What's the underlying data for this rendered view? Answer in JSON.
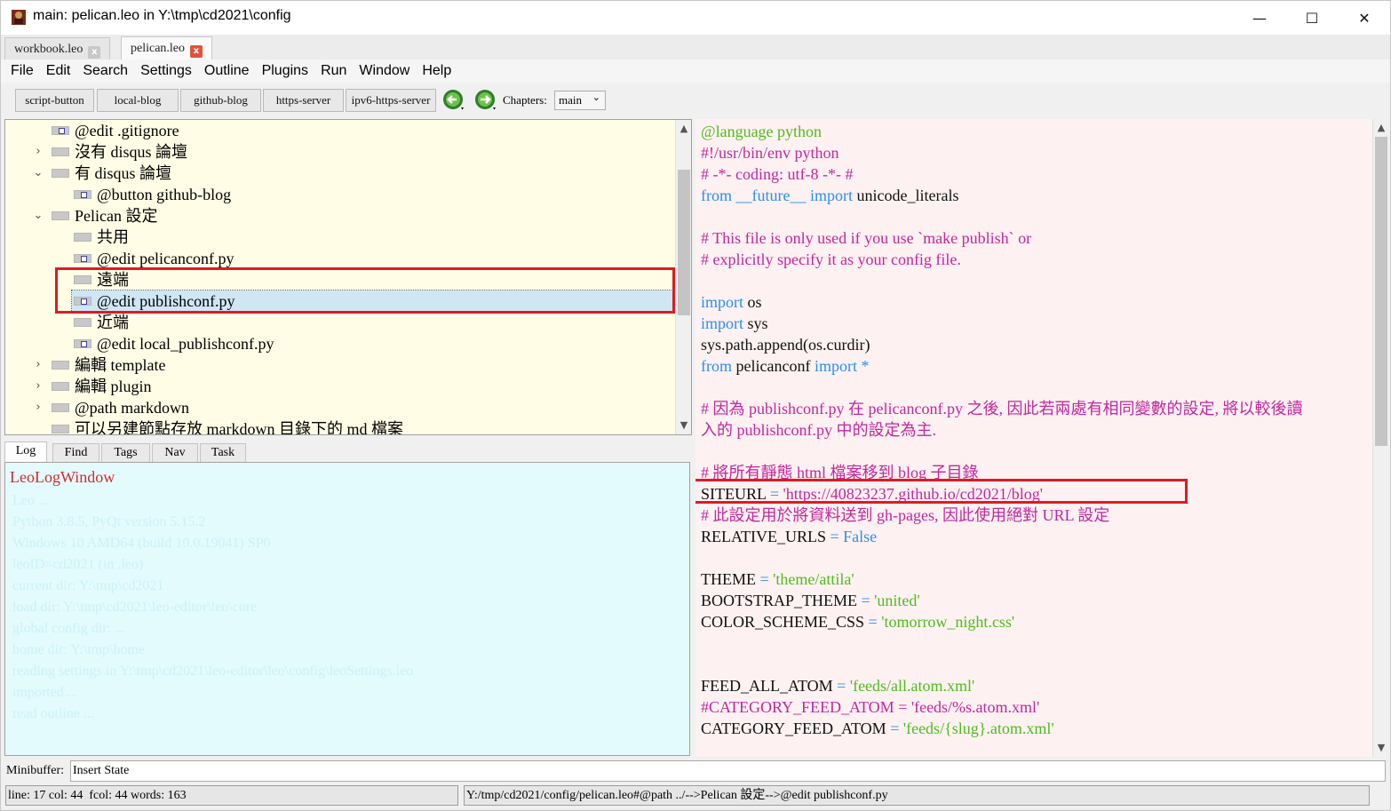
{
  "window": {
    "title": "main: pelican.leo in Y:\\tmp\\cd2021\\config",
    "min": "—",
    "max": "☐",
    "close": "✕"
  },
  "tabs": [
    {
      "label": "workbook.leo",
      "close": "x"
    },
    {
      "label": "pelican.leo",
      "close": "x"
    }
  ],
  "menu": [
    "File",
    "Edit",
    "Search",
    "Settings",
    "Outline",
    "Plugins",
    "Run",
    "Window",
    "Help"
  ],
  "toolbar": {
    "buttons": [
      "script-button",
      "local-blog",
      "github-blog",
      "https-server",
      "ipv6-https-server"
    ],
    "chapters_label": "Chapters:",
    "chapters_value": "main",
    "chev": "⌄"
  },
  "outline": {
    "twisty_closed": "›",
    "twisty_open": "⌄",
    "nodes": [
      {
        "text": "@edit .gitignore"
      },
      {
        "text": "沒有 disqus 論壇"
      },
      {
        "text": "有 disqus 論壇"
      },
      {
        "text": "@button github-blog"
      },
      {
        "text": "Pelican 設定"
      },
      {
        "text": "共用"
      },
      {
        "text": "@edit pelicanconf.py"
      },
      {
        "text": "遠端"
      },
      {
        "text": "@edit publishconf.py"
      },
      {
        "text": "近端"
      },
      {
        "text": "@edit local_publishconf.py"
      },
      {
        "text": "編輯 template"
      },
      {
        "text": "編輯 plugin"
      },
      {
        "text": "@path markdown"
      },
      {
        "text": "可以另建節點存放 markdown 目錄下的 md 檔案"
      }
    ],
    "scroll_up": "▲",
    "scroll_down": "▼"
  },
  "log_tabs": [
    "Log",
    "Find",
    "Tags",
    "Nav",
    "Task"
  ],
  "log": {
    "title": "LeoLogWindow",
    "lines": [
      "Leo ...",
      "Python 3.8.5, PyQt version 5.15.2",
      "Windows 10 AMD64 (build 10.0.19041) SP0",
      "leoID=cd2021 (in .leo)",
      "current dir: Y:\\tmp\\cd2021",
      "load dir: Y:\\tmp\\cd2021\\leo-editor\\leo\\core",
      "global config dir: ...",
      "home dir: Y:\\tmp\\home",
      "reading settings in Y:\\tmp\\cd2021\\leo-editor\\leo\\config\\leoSettings.leo",
      "imported ...",
      "read outline ..."
    ]
  },
  "body": {
    "lines": [
      [
        {
          "t": "@language python",
          "c": "green"
        }
      ],
      [
        {
          "t": "#!/usr/bin/env python",
          "c": "comment"
        }
      ],
      [
        {
          "t": "# -*- coding: utf-8 -*- #",
          "c": "comment"
        }
      ],
      [
        {
          "t": "from",
          "c": "kw"
        },
        {
          "t": " ",
          "c": "plain"
        },
        {
          "t": "__future__",
          "c": "kw"
        },
        {
          "t": " ",
          "c": "plain"
        },
        {
          "t": "import",
          "c": "kw"
        },
        {
          "t": " unicode_literals",
          "c": "plain"
        }
      ],
      [],
      [
        {
          "t": "# This file is only used if you use `make publish` or",
          "c": "comment"
        }
      ],
      [
        {
          "t": "# explicitly specify it as your config file.",
          "c": "comment"
        }
      ],
      [],
      [
        {
          "t": "import",
          "c": "kw"
        },
        {
          "t": " os",
          "c": "plain"
        }
      ],
      [
        {
          "t": "import",
          "c": "kw"
        },
        {
          "t": " sys",
          "c": "plain"
        }
      ],
      [
        {
          "t": "sys.path.append(os.curdir)",
          "c": "plain"
        }
      ],
      [
        {
          "t": "from",
          "c": "kw"
        },
        {
          "t": " pelicanconf ",
          "c": "plain"
        },
        {
          "t": "import",
          "c": "kw"
        },
        {
          "t": " *",
          "c": "kw"
        }
      ],
      [],
      [
        {
          "t": "# 因為 publishconf.py 在 pelicanconf.py 之後, 因此若兩處有相同變數的設定, 將以較後讀",
          "c": "comment"
        }
      ],
      [
        {
          "t": "入的 publishconf.py 中的設定為主.",
          "c": "comment"
        }
      ],
      [],
      [
        {
          "t": "# 將所有靜態 html 檔案移到 blog 子目錄",
          "c": "comment"
        }
      ],
      [
        {
          "t": "SITEURL",
          "c": "plain"
        },
        {
          "t": " = ",
          "c": "kw"
        },
        {
          "t": "'https://40823237.github.io/cd2021/blog'",
          "c": "strp"
        }
      ],
      [
        {
          "t": "# 此設定用於將資料送到 gh-pages, 因此使用絕對 URL 設定",
          "c": "comment"
        }
      ],
      [
        {
          "t": "RELATIVE_URLS",
          "c": "plain"
        },
        {
          "t": " = ",
          "c": "kw"
        },
        {
          "t": "False",
          "c": "kw"
        }
      ],
      [],
      [
        {
          "t": "THEME",
          "c": "plain"
        },
        {
          "t": " = ",
          "c": "kw"
        },
        {
          "t": "'theme/attila'",
          "c": "str"
        }
      ],
      [
        {
          "t": "BOOTSTRAP_THEME",
          "c": "plain"
        },
        {
          "t": " = ",
          "c": "kw"
        },
        {
          "t": "'united'",
          "c": "str"
        }
      ],
      [
        {
          "t": "COLOR_SCHEME_CSS",
          "c": "plain"
        },
        {
          "t": " = ",
          "c": "kw"
        },
        {
          "t": "'tomorrow_night.css'",
          "c": "str"
        }
      ],
      [],
      [],
      [
        {
          "t": "FEED_ALL_ATOM",
          "c": "plain"
        },
        {
          "t": " = ",
          "c": "kw"
        },
        {
          "t": "'feeds/all.atom.xml'",
          "c": "str"
        }
      ],
      [
        {
          "t": "#CATEGORY_FEED_ATOM = 'feeds/%s.atom.xml'",
          "c": "comment"
        }
      ],
      [
        {
          "t": "CATEGORY_FEED_ATOM",
          "c": "plain"
        },
        {
          "t": " = ",
          "c": "kw"
        },
        {
          "t": "'feeds/{slug}.atom.xml'",
          "c": "str"
        }
      ]
    ]
  },
  "minibuffer": {
    "label": "Minibuffer:",
    "value": "Insert State"
  },
  "status": {
    "left": "line: 17 col: 44  fcol: 44 words: 163",
    "right": "Y:/tmp/cd2021/config/pelican.leo#@path ../-->Pelican 設定-->@edit publishconf.py"
  }
}
